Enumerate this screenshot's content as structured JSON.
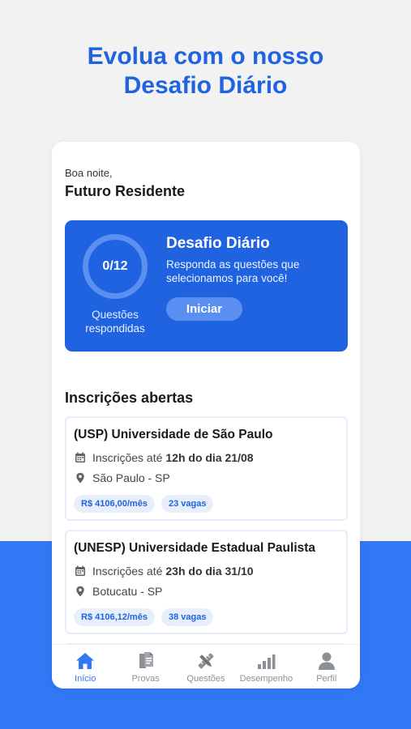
{
  "headline": {
    "line1": "Evolua com o nosso",
    "line2": "Desafio Diário"
  },
  "greeting": {
    "salutation": "Boa noite,",
    "name": "Futuro Residente"
  },
  "challenge": {
    "count": "0/12",
    "answered_label": "Questões respondidas",
    "title": "Desafio Diário",
    "description": "Responda as questões que selecionamos para você!",
    "button": "Iniciar"
  },
  "section_title": "Inscrições abertas",
  "listings": [
    {
      "title": "(USP) Universidade de São Paulo",
      "deadline_prefix": "Inscrições até",
      "deadline": "12h do dia 21/08",
      "location": "São Paulo - SP",
      "salary": "R$ 4106,00/mês",
      "vacancies": "23 vagas"
    },
    {
      "title": "(UNESP) Universidade Estadual Paulista",
      "deadline_prefix": "Inscrições até",
      "deadline": "23h do dia 31/10",
      "location": "Botucatu - SP",
      "salary": "R$ 4106,12/mês",
      "vacancies": "38 vagas"
    }
  ],
  "tabs": [
    {
      "label": "Início",
      "icon": "home-icon",
      "active": true
    },
    {
      "label": "Provas",
      "icon": "documents-icon",
      "active": false
    },
    {
      "label": "Questões",
      "icon": "pencil-ruler-icon",
      "active": false
    },
    {
      "label": "Desempenho",
      "icon": "bar-chart-icon",
      "active": false
    },
    {
      "label": "Perfil",
      "icon": "user-icon",
      "active": false
    }
  ],
  "colors": {
    "brand_blue": "#1f63e0",
    "accent_blue": "#3277f4",
    "tag_background": "#e8effb",
    "inactive_tab": "#8b8f96"
  }
}
